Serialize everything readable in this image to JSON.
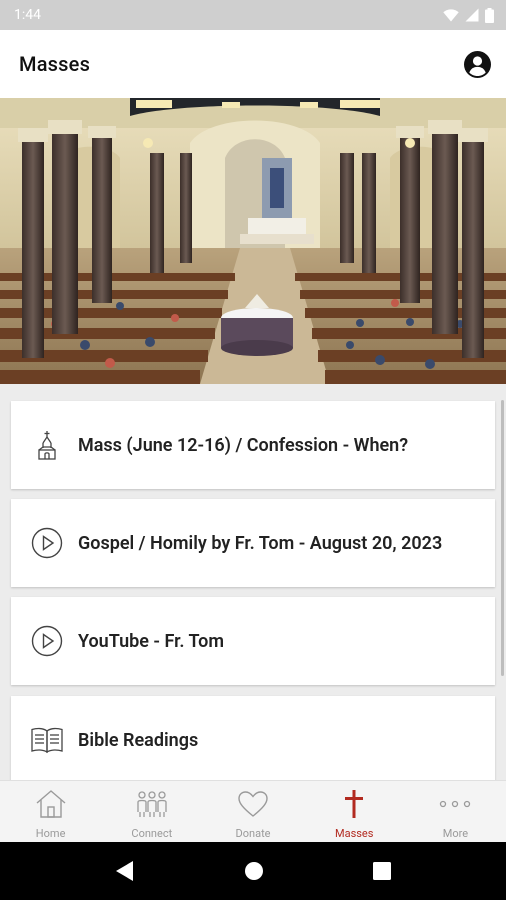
{
  "status_bar": {
    "time": "1:44"
  },
  "app_bar": {
    "title": "Masses"
  },
  "items": [
    {
      "label": "Mass (June 12-16) / Confession - When?",
      "icon": "church-icon"
    },
    {
      "label": "Gospel / Homily by Fr. Tom - August 20, 2023",
      "icon": "play-circle-icon"
    },
    {
      "label": "YouTube - Fr. Tom",
      "icon": "play-circle-icon"
    },
    {
      "label": "Bible Readings",
      "icon": "book-icon"
    }
  ],
  "bottom_nav": [
    {
      "label": "Home",
      "icon": "home-icon"
    },
    {
      "label": "Connect",
      "icon": "people-icon"
    },
    {
      "label": "Donate",
      "icon": "heart-icon"
    },
    {
      "label": "Masses",
      "icon": "cross-icon",
      "active": true
    },
    {
      "label": "More",
      "icon": "more-icon"
    }
  ],
  "colors": {
    "accent": "#b22a20",
    "status_bar": "#cfcfcf",
    "background": "#ececec"
  }
}
